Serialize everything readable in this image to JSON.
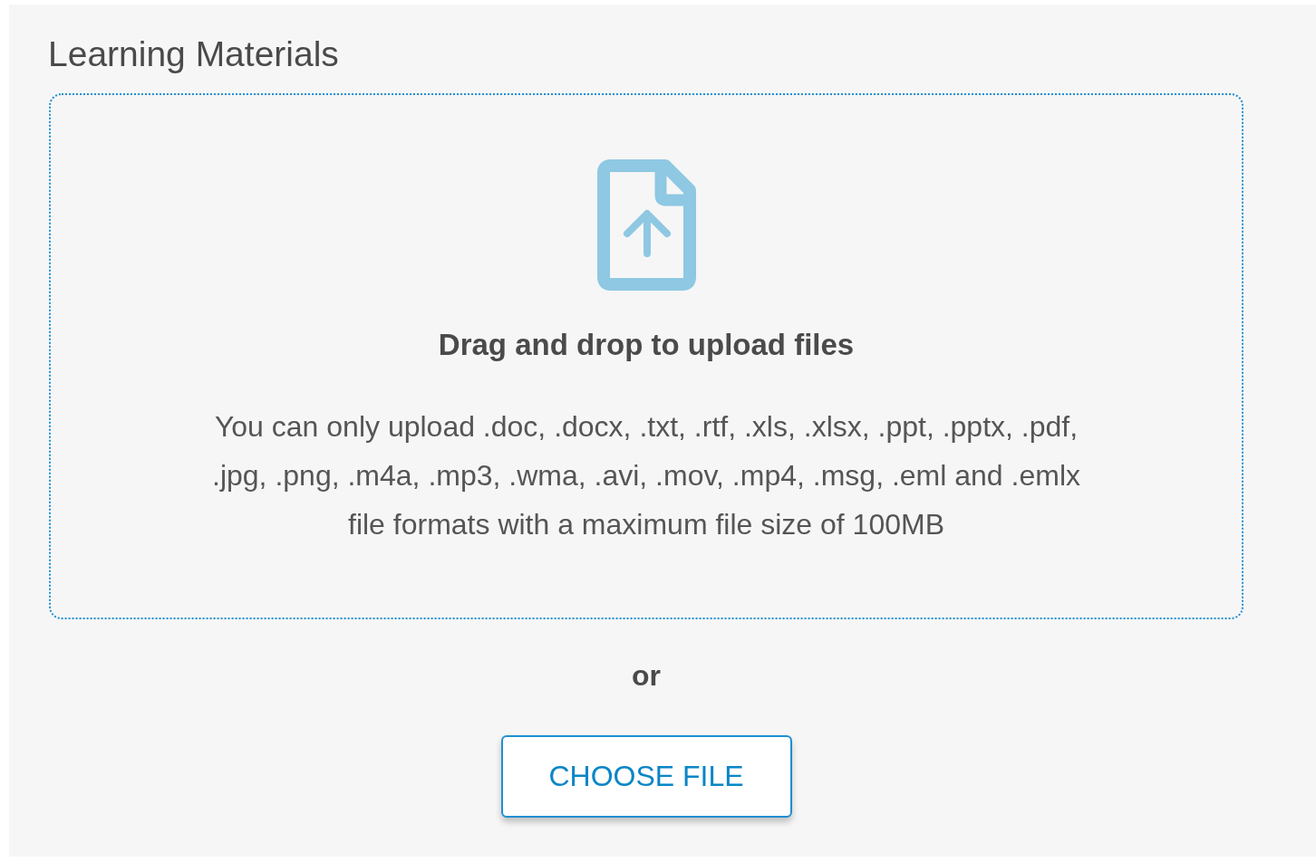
{
  "section": {
    "title": "Learning Materials"
  },
  "drop_zone": {
    "heading": "Drag and drop to upload files",
    "description": "You can only upload .doc, .docx, .txt, .rtf, .xls, .xlsx, .ppt, .pptx, .pdf, .jpg, .png, .m4a, .mp3, .wma, .avi, .mov, .mp4, .msg, .eml and .emlx file formats with a maximum file size of 100MB"
  },
  "separator": "or",
  "button": {
    "label": "CHOOSE FILE"
  }
}
